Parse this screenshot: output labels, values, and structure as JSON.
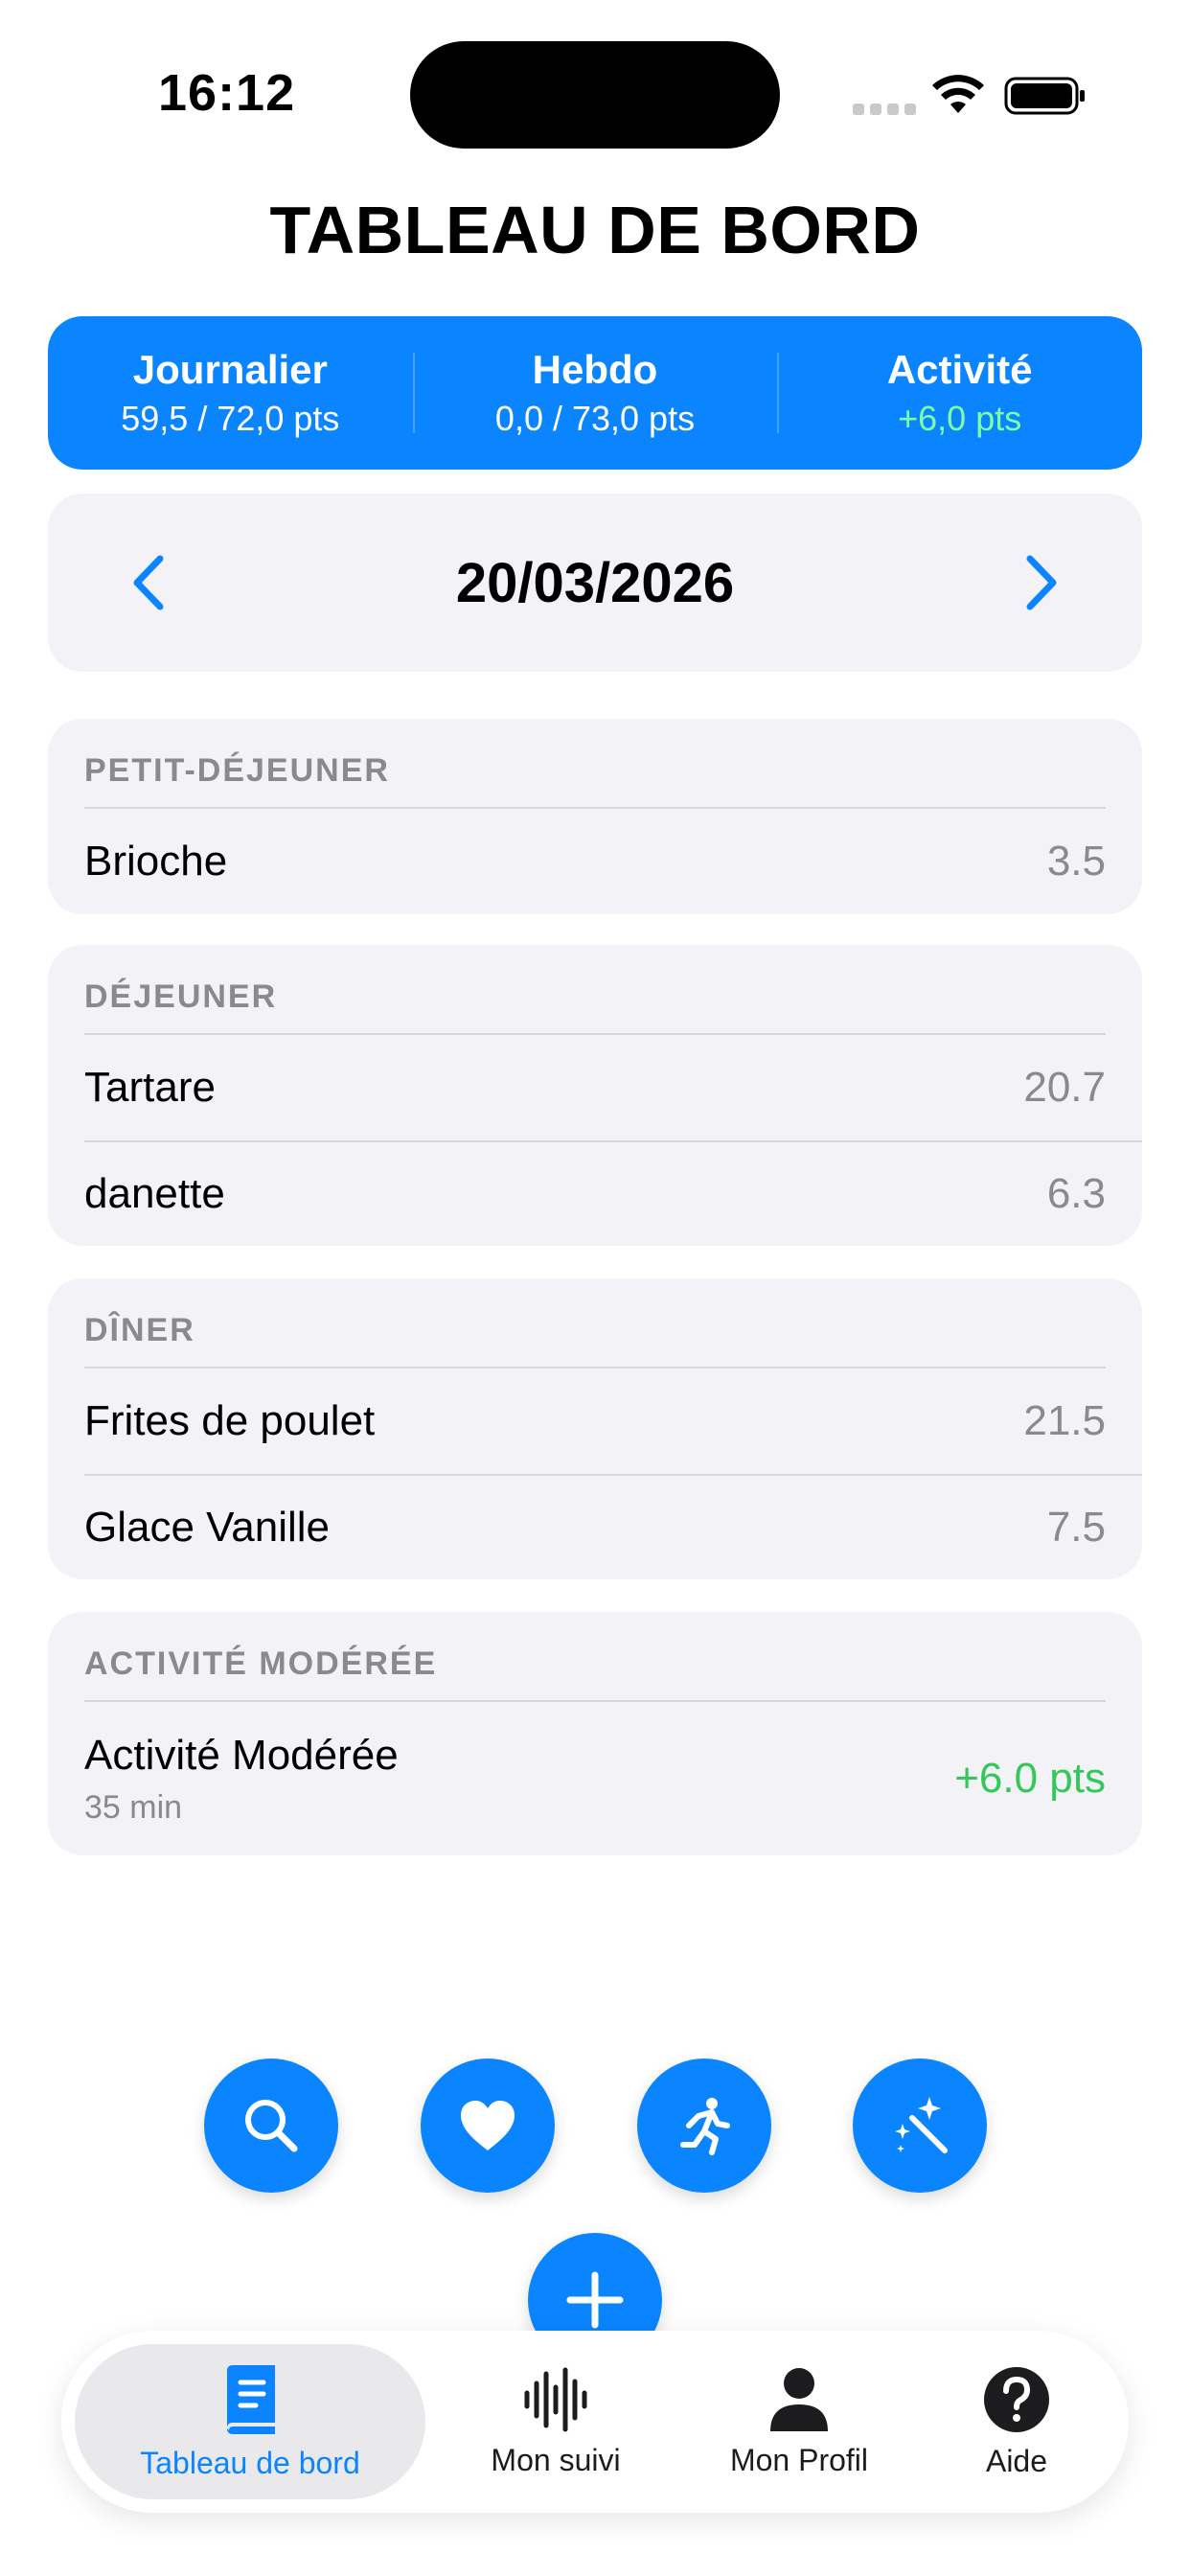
{
  "status_bar": {
    "time": "16:12"
  },
  "page_title": "TABLEAU DE BORD",
  "summary": [
    {
      "label": "Journalier",
      "value": "59,5 / 72,0 pts"
    },
    {
      "label": "Hebdo",
      "value": "0,0 / 73,0 pts"
    },
    {
      "label": "Activité",
      "value": "+6,0 pts"
    }
  ],
  "date_nav": {
    "date": "20/03/2026"
  },
  "meals": [
    {
      "title": "PETIT-DÉJEUNER",
      "items": [
        {
          "name": "Brioche",
          "points": "3.5"
        }
      ]
    },
    {
      "title": "DÉJEUNER",
      "items": [
        {
          "name": "Tartare",
          "points": "20.7"
        },
        {
          "name": "danette",
          "points": "6.3"
        }
      ]
    },
    {
      "title": "DÎNER",
      "items": [
        {
          "name": "Frites de poulet",
          "points": "21.5"
        },
        {
          "name": "Glace Vanille",
          "points": "7.5"
        }
      ]
    }
  ],
  "activity": {
    "title": "ACTIVITÉ MODÉRÉE",
    "name": "Activité Modérée",
    "duration": "35 min",
    "points": "+6.0 pts"
  },
  "actions": {
    "icons": [
      "search-icon",
      "heart-icon",
      "running-icon",
      "magic-wand-icon",
      "plus-icon"
    ]
  },
  "tabbar": [
    {
      "label": "Tableau de bord",
      "icon": "book-icon",
      "active": true
    },
    {
      "label": "Mon suivi",
      "icon": "waveform-icon",
      "active": false
    },
    {
      "label": "Mon Profil",
      "icon": "person-icon",
      "active": false
    },
    {
      "label": "Aide",
      "icon": "question-icon",
      "active": false
    }
  ],
  "colors": {
    "accent": "#0a84ff",
    "positive": "#34c759",
    "card_bg": "#f2f2f7",
    "secondary_text": "#8a8a8e"
  }
}
